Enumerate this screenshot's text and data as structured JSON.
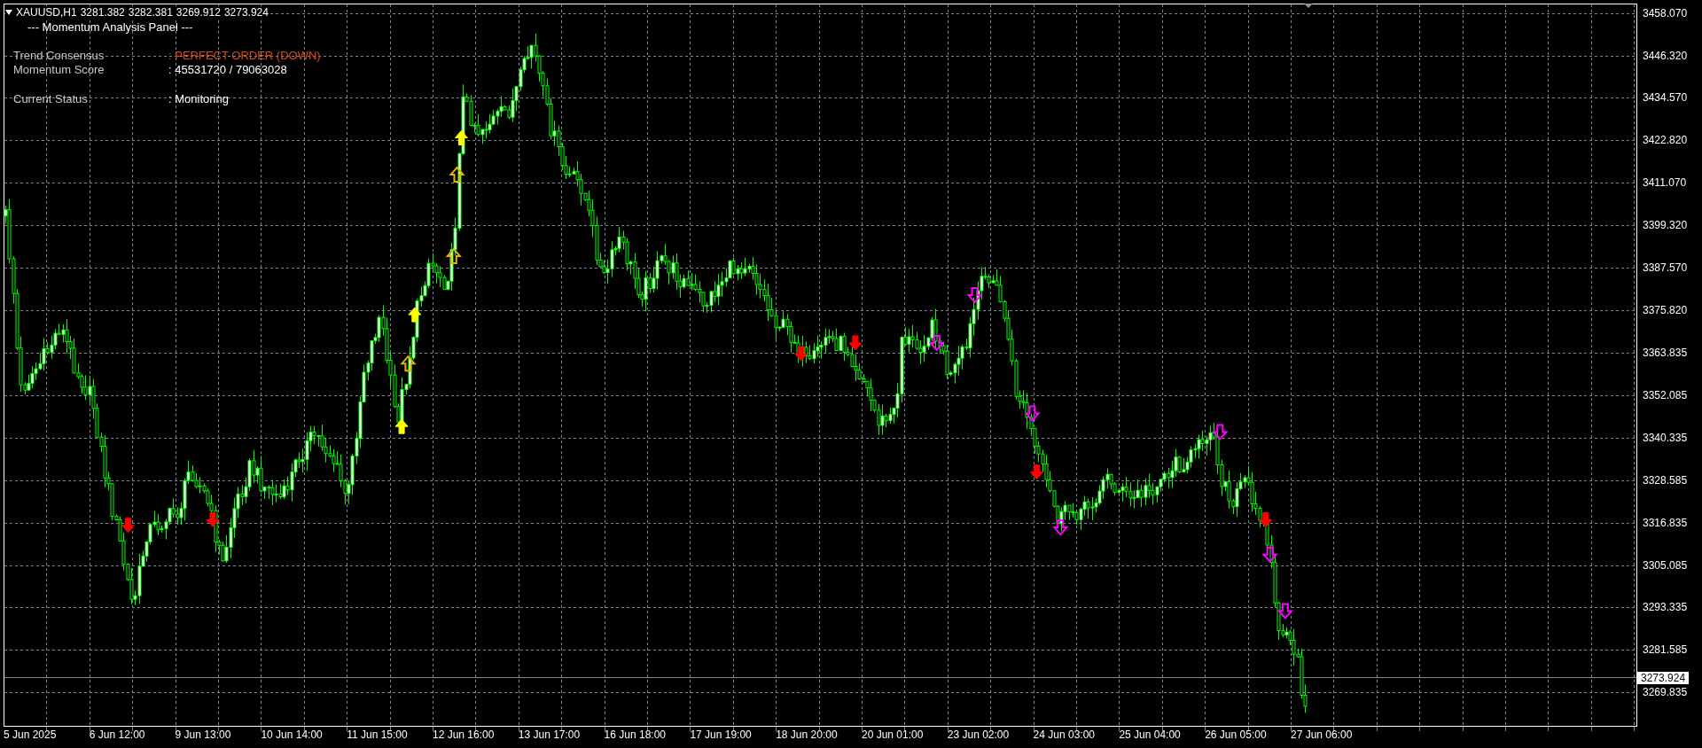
{
  "header": {
    "symbol": "XAUUSD,H1",
    "prices": [
      "3281.382",
      "3282.381",
      "3269.912",
      "3273.924"
    ]
  },
  "panel": {
    "title": "--- Momentum Analysis Panel ---",
    "groups": [
      [
        {
          "label": "Trend Consensus",
          "value": ": PERFECT ORDER (DOWN)",
          "color": "#e0461b"
        },
        {
          "label": "Momentum Score",
          "value": ": 45531720 / 79063028",
          "color": "#ffffff"
        }
      ],
      [
        {
          "label": "Current Status",
          "value": ": Monitoring",
          "color": "#ffffff"
        }
      ]
    ]
  },
  "price_axis": {
    "ticks": [
      "3458.070",
      "3446.320",
      "3434.570",
      "3422.820",
      "3411.070",
      "3399.320",
      "3387.570",
      "3375.820",
      "3363.835",
      "3352.085",
      "3340.335",
      "3328.585",
      "3316.835",
      "3305.085",
      "3293.335",
      "3281.585",
      "3269.835"
    ],
    "current_price": "3273.924"
  },
  "time_axis": {
    "labels": [
      "5 Jun 2025",
      "6 Jun 12:00",
      "9 Jun 13:00",
      "10 Jun 14:00",
      "11 Jun 15:00",
      "12 Jun 16:00",
      "13 Jun 17:00",
      "16 Jun 18:00",
      "17 Jun 19:00",
      "18 Jun 20:00",
      "20 Jun 01:00",
      "23 Jun 02:00",
      "24 Jun 03:00",
      "25 Jun 04:00",
      "26 Jun 05:00",
      "27 Jun 06:00"
    ]
  }
}
